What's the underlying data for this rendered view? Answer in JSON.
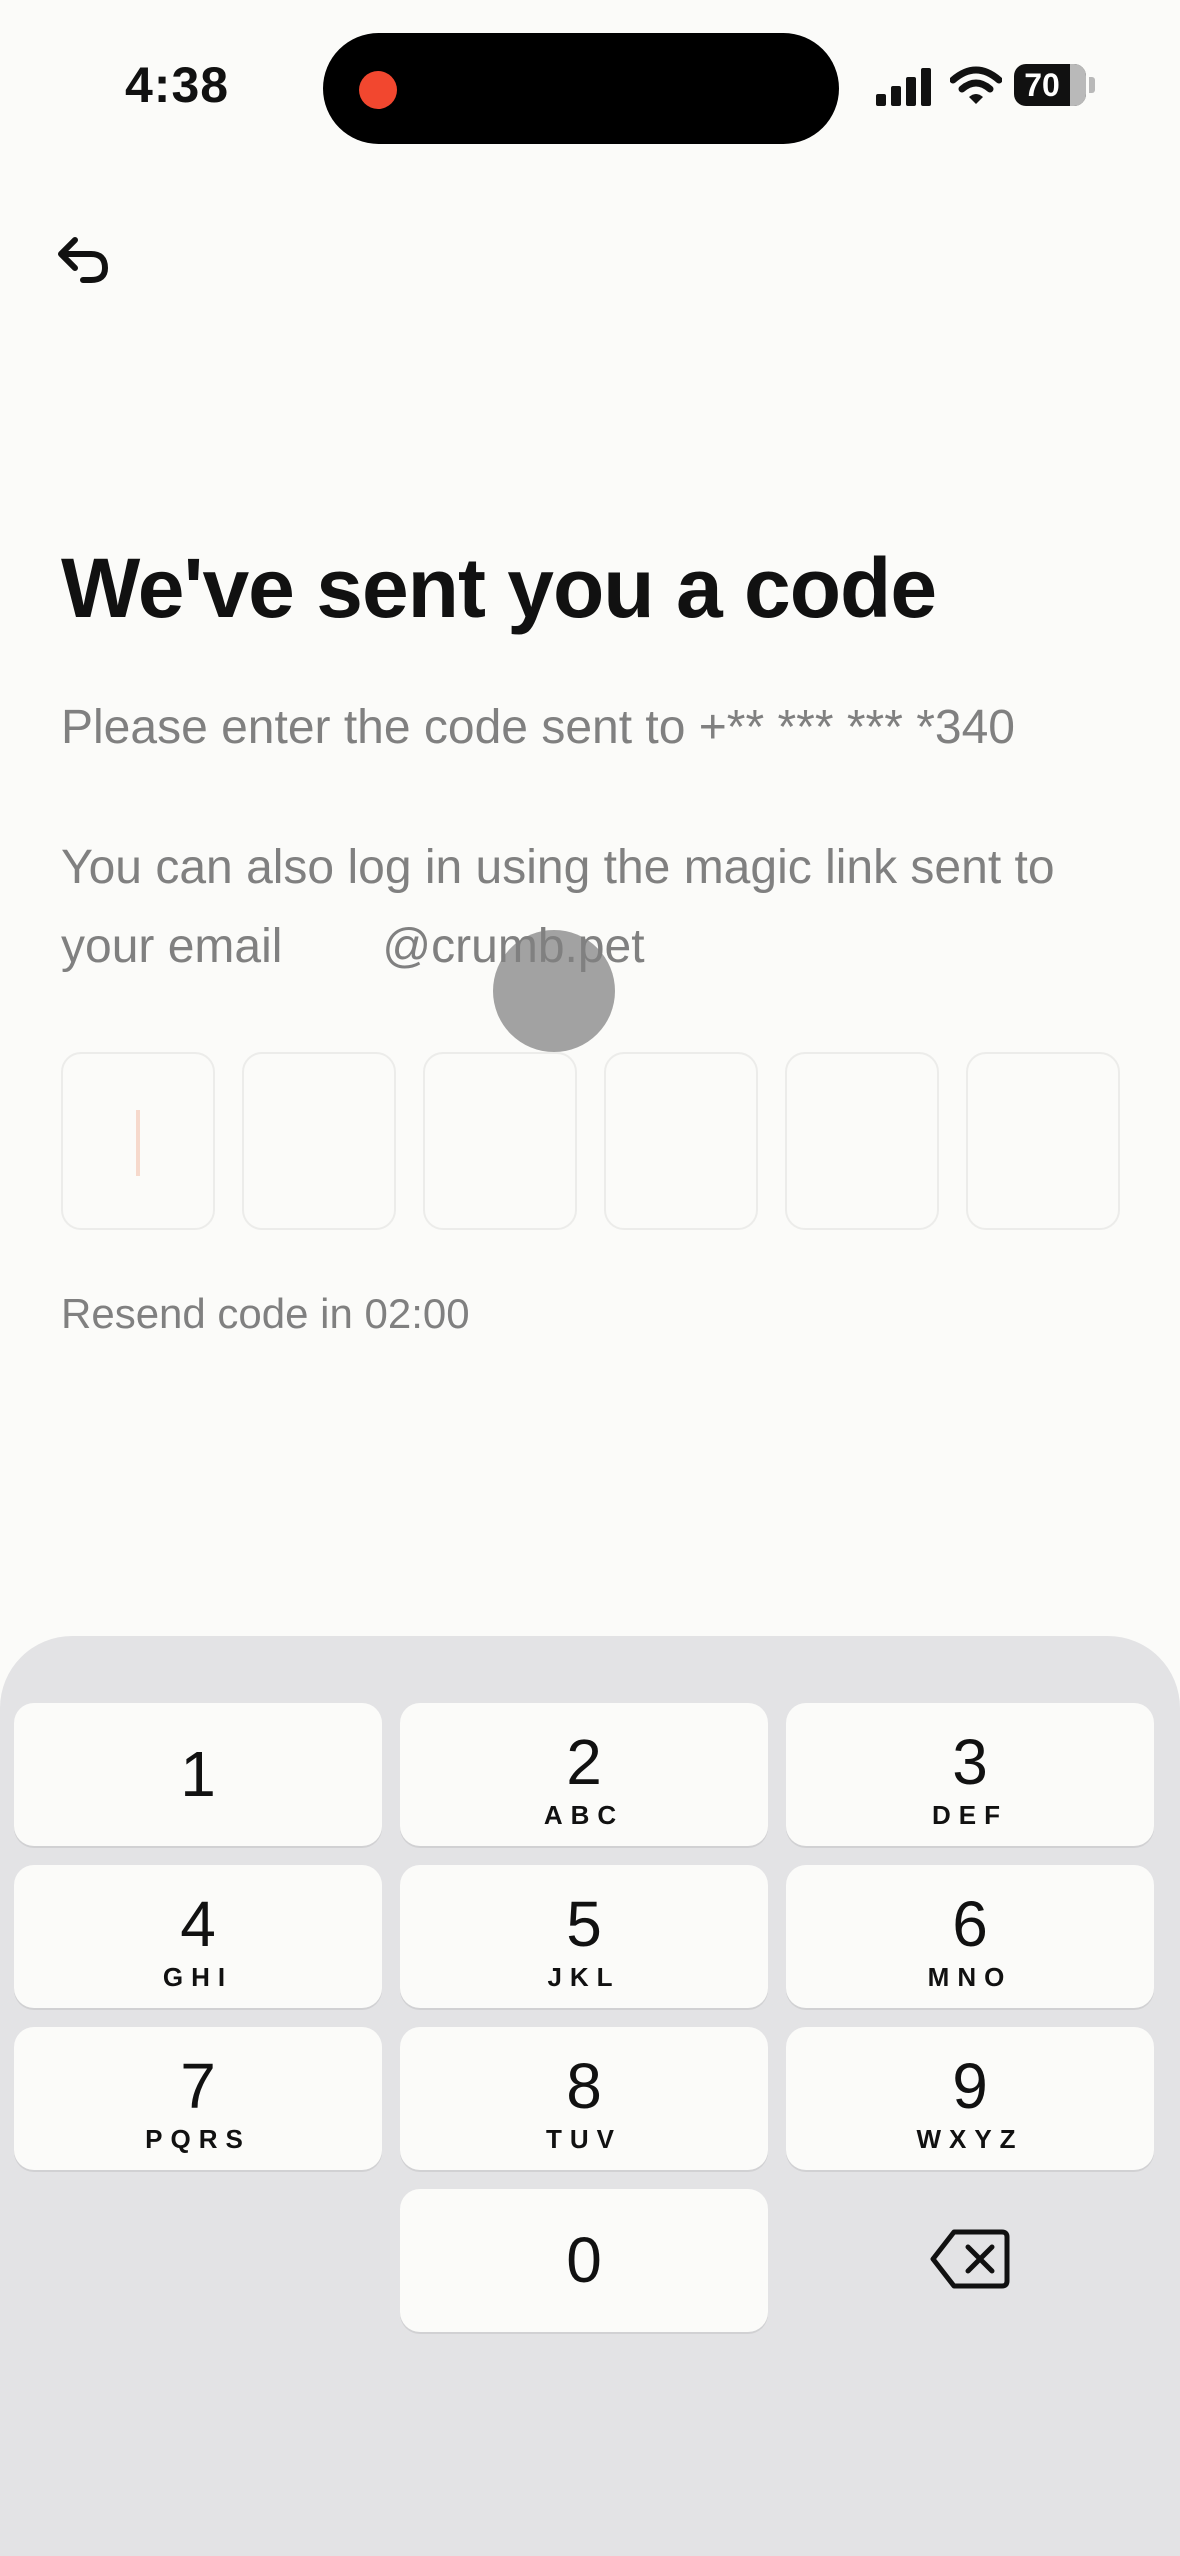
{
  "status_bar": {
    "time": "4:38",
    "battery_level": "70"
  },
  "screen": {
    "title": "We've sent you a code",
    "subtitle": "Please enter the code sent to +** *** *** *340",
    "magic_link_prefix": "You can also log in using the magic link sent to your email",
    "email_domain": "@crumb.pet",
    "resend_text": "Resend code in 02:00",
    "code_length": 6,
    "code_values": [
      "",
      "",
      "",
      "",
      "",
      ""
    ]
  },
  "keypad": {
    "keys": [
      {
        "digit": "1",
        "letters": ""
      },
      {
        "digit": "2",
        "letters": "ABC"
      },
      {
        "digit": "3",
        "letters": "DEF"
      },
      {
        "digit": "4",
        "letters": "GHI"
      },
      {
        "digit": "5",
        "letters": "JKL"
      },
      {
        "digit": "6",
        "letters": "MNO"
      },
      {
        "digit": "7",
        "letters": "PQRS"
      },
      {
        "digit": "8",
        "letters": "TUV"
      },
      {
        "digit": "9",
        "letters": "WXYZ"
      },
      {
        "digit": "0",
        "letters": ""
      }
    ],
    "delete_icon": "backspace-icon"
  },
  "icons": {
    "back": "back-arrow-icon",
    "signal": "cellular-signal-icon",
    "wifi": "wifi-icon",
    "battery": "battery-icon",
    "recording": "recording-dot-icon"
  },
  "colors": {
    "background": "#fbfbf9",
    "recording": "#f2472f",
    "keypad_bg": "#e3e3e5",
    "muted_text": "#808080",
    "caret": "#f6d9cc"
  }
}
